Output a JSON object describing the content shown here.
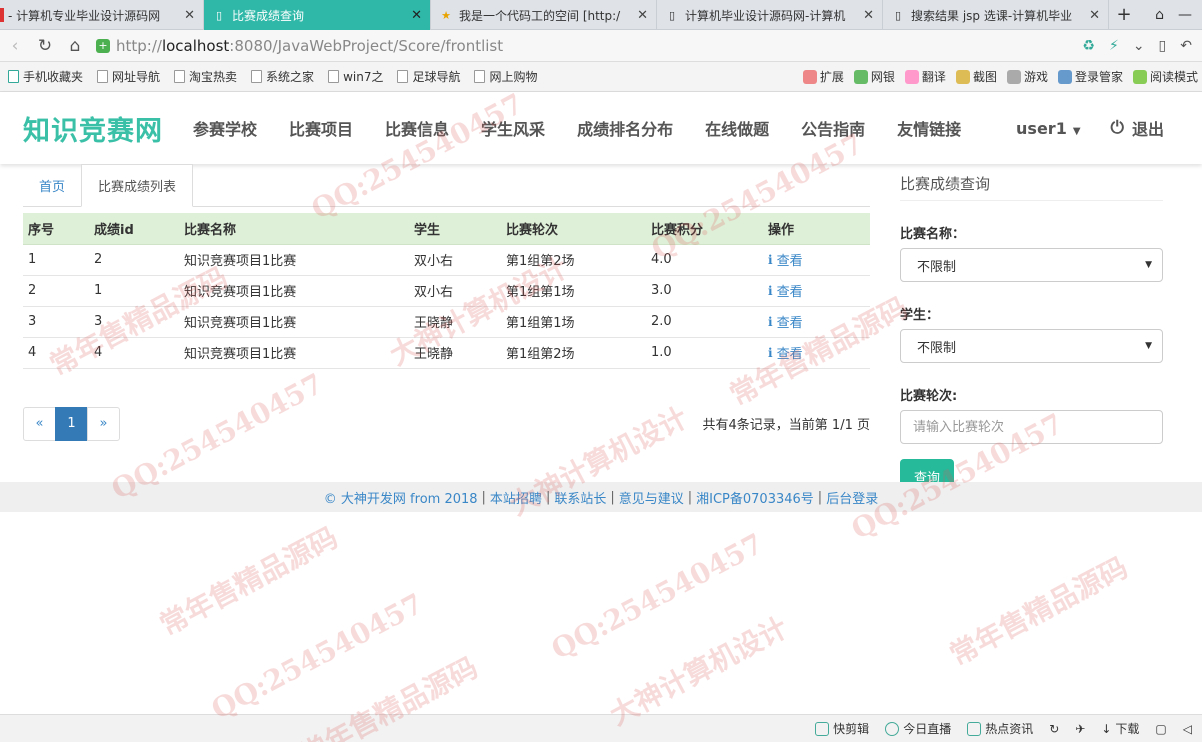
{
  "browser": {
    "tabs": [
      {
        "title": "- 计算机专业毕业设计源码网",
        "active": false,
        "icon": "page-icon"
      },
      {
        "title": "比赛成绩查询",
        "active": true,
        "icon": "page-icon"
      },
      {
        "title": "我是一个代码工的空间 [http:/",
        "active": false,
        "icon": "star-icon"
      },
      {
        "title": "计算机毕业设计源码网-计算机",
        "active": false,
        "icon": "page-icon"
      },
      {
        "title": "搜索结果 jsp 选课-计算机毕业",
        "active": false,
        "icon": "page-icon"
      }
    ],
    "new_tab": "+",
    "address": {
      "prefix": "http://",
      "host": "localhost",
      "path": ":8080/JavaWebProject/Score/frontlist"
    },
    "bookmarks": [
      "手机收藏夹",
      "网址导航",
      "淘宝热卖",
      "系统之家",
      "win7之",
      "足球导航",
      "网上购物"
    ],
    "extensions": [
      "扩展",
      "网银",
      "翻译",
      "截图",
      "游戏",
      "登录管家",
      "阅读模式"
    ]
  },
  "site": {
    "logo": "知识竞赛网",
    "nav": [
      "参赛学校",
      "比赛项目",
      "比赛信息",
      "学生风采",
      "成绩排名分布",
      "在线做题",
      "公告指南",
      "友情链接"
    ],
    "user": "user1",
    "logout": "退出"
  },
  "content": {
    "crumb_home": "首页",
    "crumb_current": "比赛成绩列表",
    "table": {
      "headers": [
        "序号",
        "成绩id",
        "比赛名称",
        "学生",
        "比赛轮次",
        "比赛积分",
        "操作"
      ],
      "rows": [
        [
          "1",
          "2",
          "知识竞赛项目1比赛",
          "双小右",
          "第1组第2场",
          "4.0",
          "查看"
        ],
        [
          "2",
          "1",
          "知识竞赛项目1比赛",
          "双小右",
          "第1组第1场",
          "3.0",
          "查看"
        ],
        [
          "3",
          "3",
          "知识竞赛项目1比赛",
          "王晓静",
          "第1组第1场",
          "2.0",
          "查看"
        ],
        [
          "4",
          "4",
          "知识竞赛项目1比赛",
          "王晓静",
          "第1组第2场",
          "1.0",
          "查看"
        ]
      ]
    },
    "pager": {
      "prev": "«",
      "current": "1",
      "next": "»"
    },
    "page_info": "共有4条记录，当前第 1/1 页"
  },
  "sidebar": {
    "title": "比赛成绩查询",
    "contest_label": "比赛名称：",
    "contest_value": "不限制",
    "student_label": "学生：",
    "student_value": "不限制",
    "round_label": "比赛轮次:",
    "round_placeholder": "请输入比赛轮次",
    "search_button": "查询"
  },
  "footer": {
    "copyright": "© 大神开发网 from 2018",
    "links": [
      "本站招聘",
      "联系站长",
      "意见与建议",
      "湘ICP备0703346号",
      "后台登录"
    ]
  },
  "statusbar": [
    "快剪辑",
    "今日直播",
    "热点资讯",
    "下载"
  ],
  "watermark": [
    "常年售精品源码",
    "QQ:254540457",
    "大神计算机设计"
  ],
  "colors": {
    "accent": "#3bc0a8",
    "tab_active": "#2fb8a8",
    "link": "#3a87c7",
    "button": "#26b99a",
    "table_head": "#dff0d8"
  }
}
